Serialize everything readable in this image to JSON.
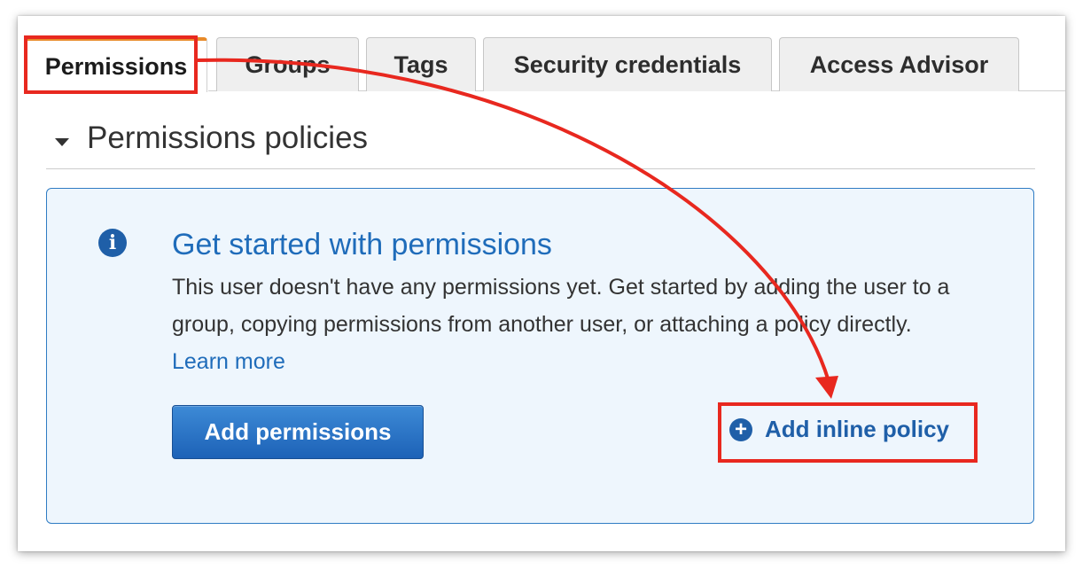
{
  "tabs": [
    {
      "label": "Permissions",
      "active": true
    },
    {
      "label": "Groups",
      "active": false
    },
    {
      "label": "Tags",
      "active": false
    },
    {
      "label": "Security credentials",
      "active": false
    },
    {
      "label": "Access Advisor",
      "active": false
    }
  ],
  "section": {
    "title": "Permissions policies",
    "expanded": true
  },
  "info": {
    "icon": "info-icon",
    "title": "Get started with permissions",
    "body": "This user doesn't have any permissions yet. Get started by adding the user to a group, copying permissions from another user, or attaching a policy directly.",
    "link_text": "Learn more"
  },
  "actions": {
    "add_permissions_label": "Add permissions",
    "add_inline_policy_label": "Add inline policy",
    "add_inline_policy_icon": "plus-circle-icon"
  },
  "colors": {
    "accent_tab": "#e88b2a",
    "link_blue": "#1f6cba",
    "primary_button": "#1d62b7",
    "info_background": "#eef6fd",
    "annotation_red": "#e8281f"
  }
}
